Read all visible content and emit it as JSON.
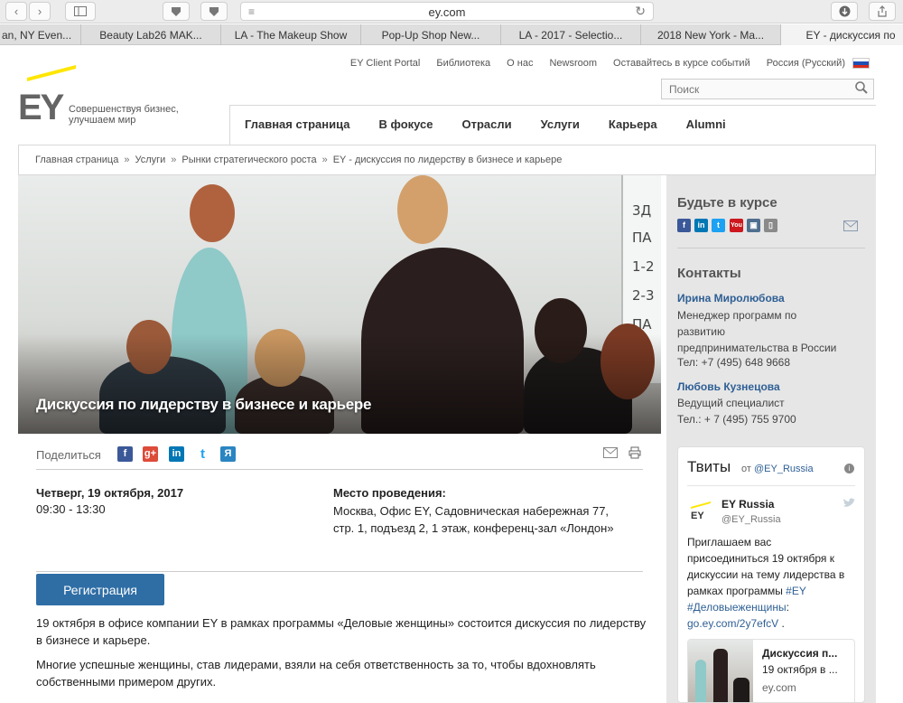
{
  "browser": {
    "url": "ey.com",
    "tabs": [
      "an, NY Even...",
      "Beauty Lab26 MAK...",
      "LA - The Makeup Show",
      "Pop-Up Shop New...",
      "LA - 2017 - Selectio...",
      "2018 New York - Ma...",
      "EY - дискуссия по"
    ]
  },
  "header": {
    "logo_text": "EY",
    "tagline_line1": "Совершенствуя бизнес,",
    "tagline_line2": "улучшаем мир",
    "utility_links": [
      "EY Client Portal",
      "Библиотека",
      "О нас",
      "Newsroom",
      "Оставайтесь в курсе событий",
      "Россия (Русский)"
    ],
    "search_placeholder": "Поиск",
    "nav": [
      "Главная страница",
      "В фокусе",
      "Отрасли",
      "Услуги",
      "Карьера",
      "Alumni"
    ]
  },
  "breadcrumb": [
    "Главная страница",
    "Услуги",
    "Рынки стратегического роста",
    "EY - дискуссия по лидерству в бизнесе и карьере"
  ],
  "breadcrumb_sep": "»",
  "hero": {
    "caption": "Дискуссия по лидерству в бизнесе и карьере",
    "whiteboard_lines": [
      "3Д",
      "ПА",
      "1-2",
      "2-3",
      "ПА"
    ]
  },
  "share": {
    "label": "Поделиться",
    "icons": [
      "f",
      "g+",
      "in",
      "t",
      "Я"
    ]
  },
  "event": {
    "date": "Четверг, 19 октября, 2017",
    "time": "09:30 - 13:30",
    "venue_title": "Место проведения:",
    "venue_text": "Москва, Офис EY, Садовническая набережная 77, стр. 1, подъезд 2, 1 этаж, конференц-зал «Лондон»",
    "register_label": "Регистрация"
  },
  "body": {
    "para1": "19 октября в офисе компании EY в рамках программы «Деловые женщины» состоится дискуссия по лидерству в бизнесе и карьере.",
    "para2": "Многие успешные женщины, став лидерами, взяли на себя  ответственность за то, чтобы вдохновлять собственными примером других."
  },
  "sidebar": {
    "stay_title": "Будьте в курсе",
    "social_icons": [
      "f",
      "in",
      "t",
      "You",
      "▣",
      "▯"
    ],
    "contacts_title": "Контакты",
    "contact1": {
      "name": "Ирина Миролюбова",
      "role": "Менеджер программ по развитию предпринимательства в России",
      "phone": "Тел: +7 (495) 648 9668"
    },
    "contact2": {
      "name": "Любовь Кузнецова",
      "role": "Ведущий специалист",
      "phone": "Тел.: + 7 (495) 755 9700"
    }
  },
  "tweets": {
    "title": "Твиты",
    "from": "от",
    "handle_link": "@EY_Russia",
    "author": "EY Russia",
    "author_handle": "@EY_Russia",
    "text": "Приглашаем вас присоединиться 19 октября к дискуссии на тему лидерства в рамках программы ",
    "hashtag1": "#EY",
    "hashtag2": "#Деловыеженщины",
    "link": "go.ey.com/2y7efcV",
    "card_title": "Дискуссия п...",
    "card_sub": "19 октября в ...",
    "card_domain": "ey.com"
  },
  "colors": {
    "ey_yellow": "#ffe600",
    "link_blue": "#2e5f94",
    "button_blue": "#2f6ea5"
  }
}
